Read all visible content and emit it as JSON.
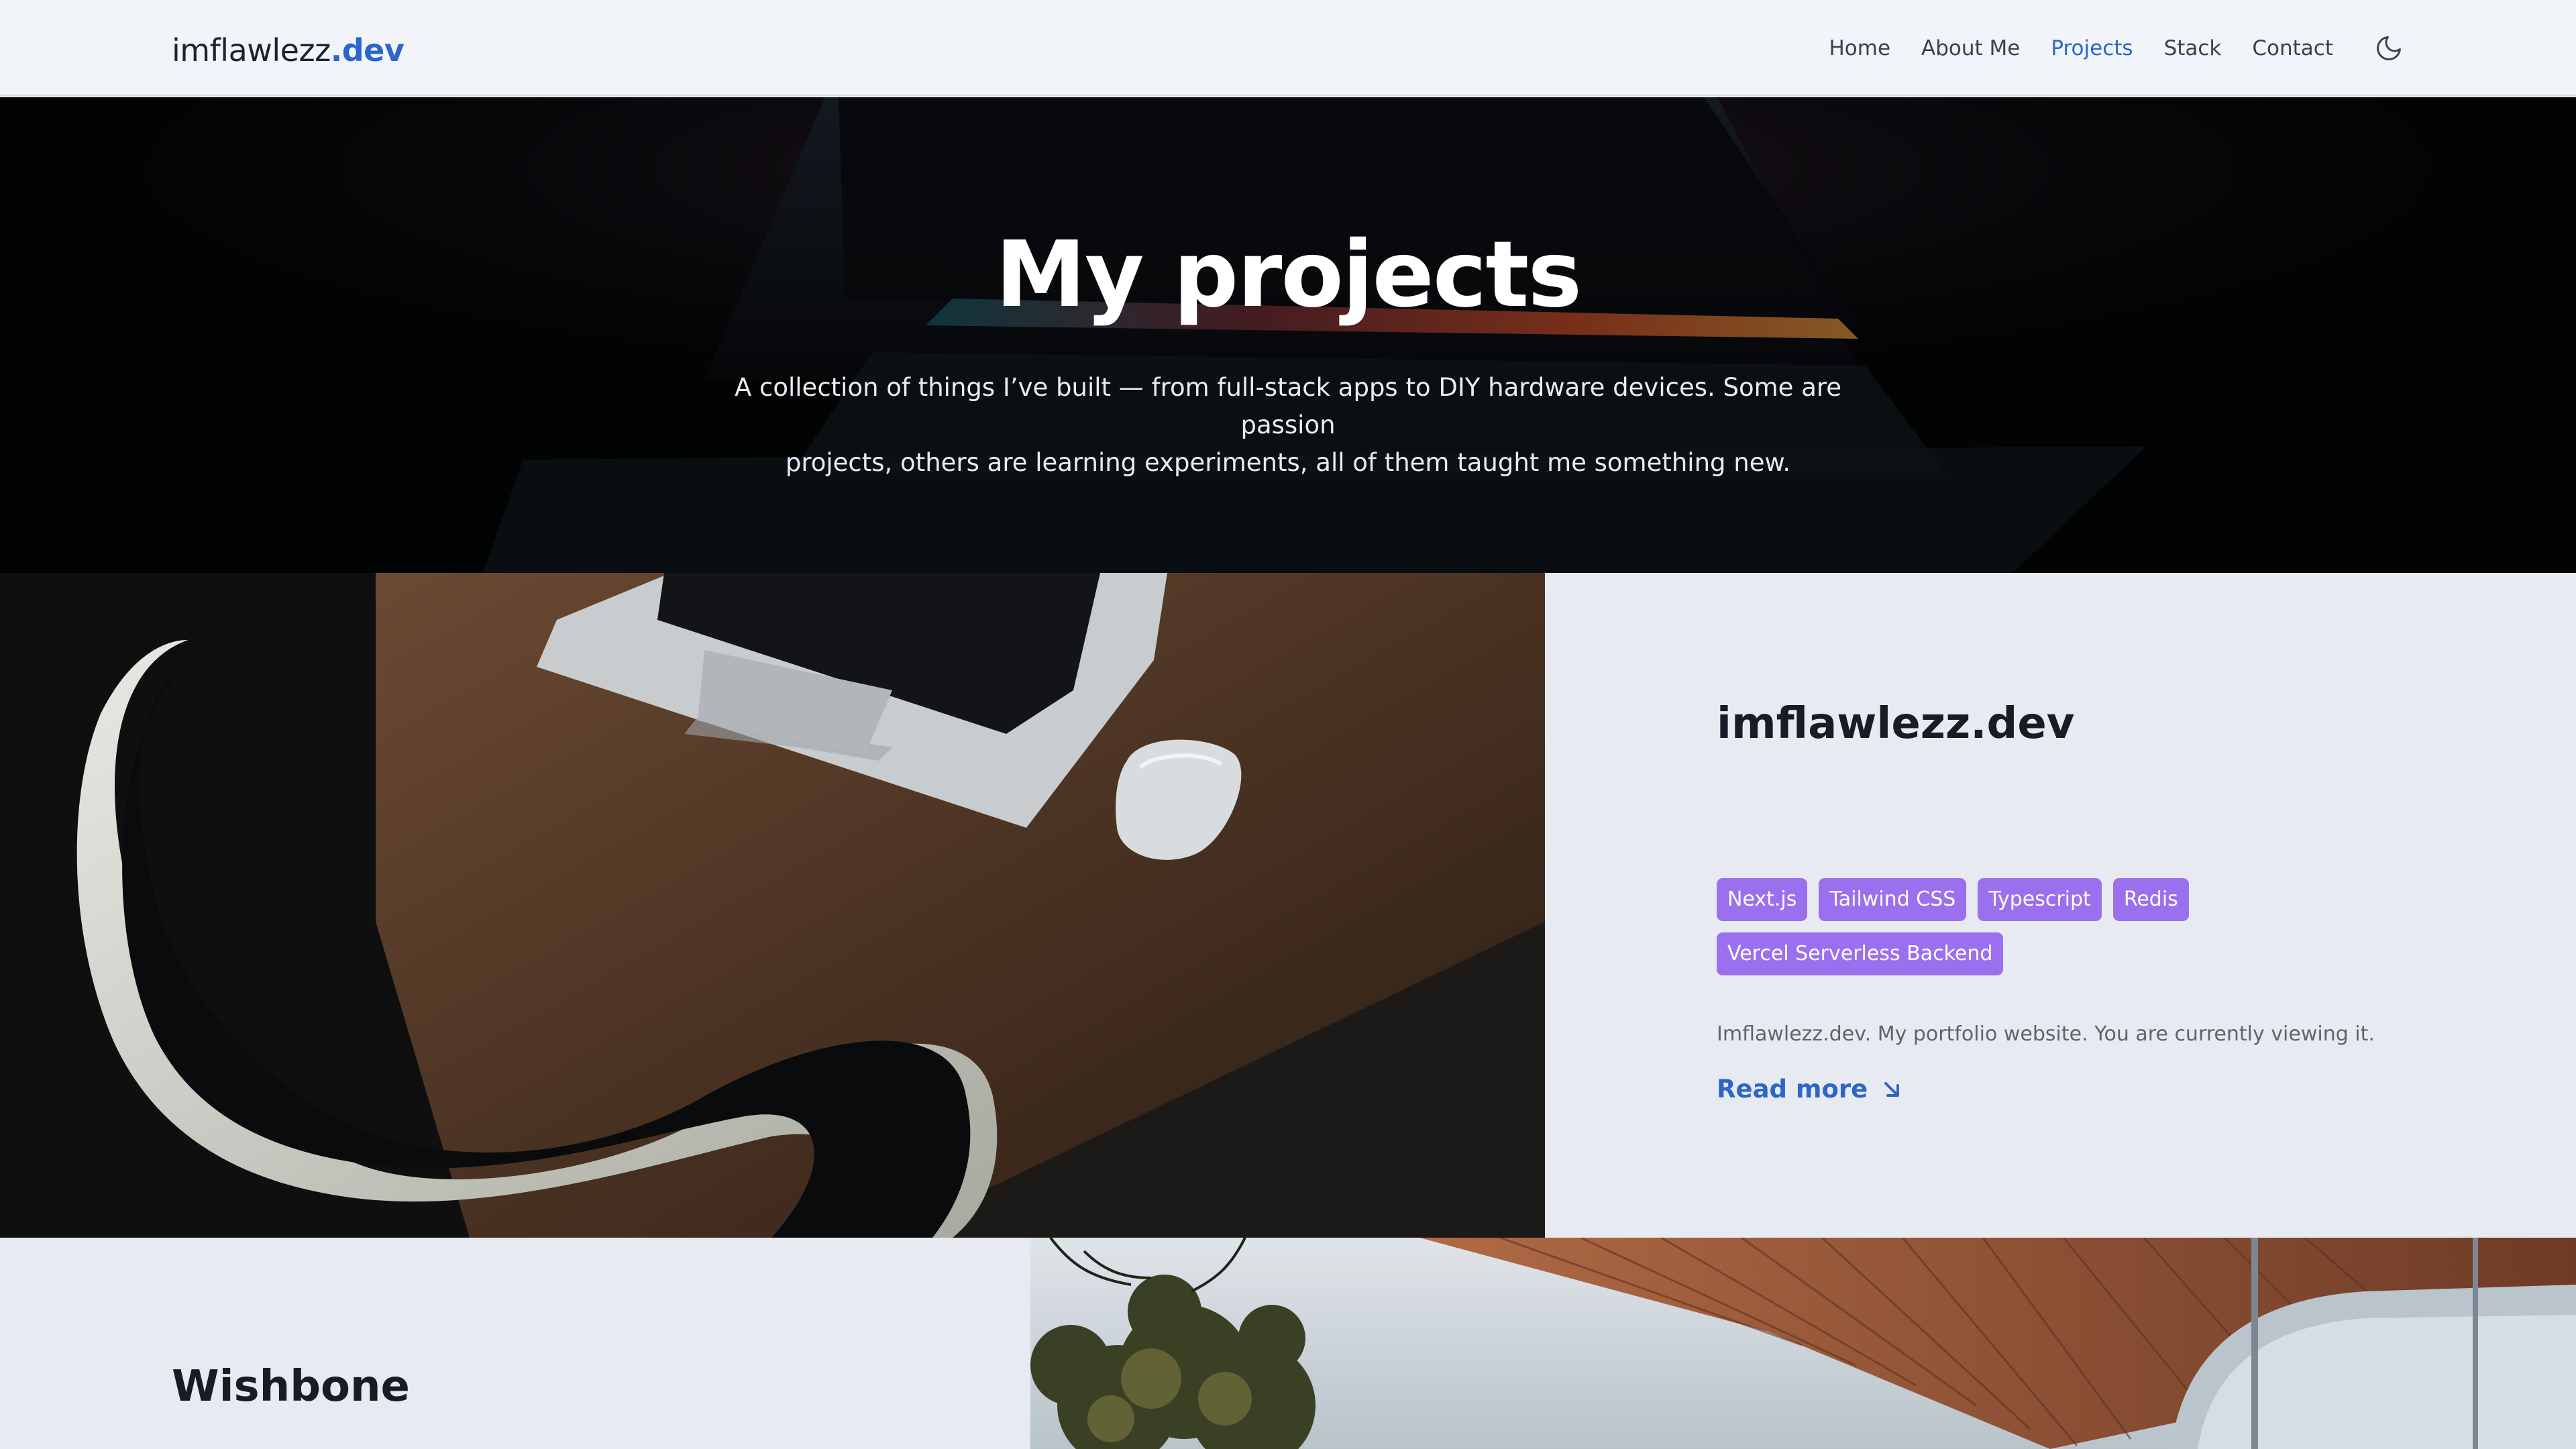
{
  "nav": {
    "logo_main": "imflawlezz",
    "logo_accent": ".dev",
    "links": [
      {
        "label": "Home"
      },
      {
        "label": "About Me"
      },
      {
        "label": "Projects",
        "active": true
      },
      {
        "label": "Stack"
      },
      {
        "label": "Contact"
      }
    ],
    "theme_icon": "moon-icon"
  },
  "hero": {
    "title": "My projects",
    "subtitle_line1": "A collection of things I’ve built — from full-stack apps to DIY hardware devices. Some are passion",
    "subtitle_line2": "projects, others are learning experiments, all of them taught me something new."
  },
  "projects": [
    {
      "title": "imflawlezz.dev",
      "tags": [
        "Next.js",
        "Tailwind CSS",
        "Typescript",
        "Redis",
        "Vercel Serverless Backend"
      ],
      "description": "Imflawlezz.dev. My portfolio website. You are currently viewing it.",
      "read_more": "Read more",
      "read_more_icon": "arrow-down-right-icon"
    },
    {
      "title": "Wishbone"
    }
  ],
  "colors": {
    "accent": "#2d65c8",
    "tag": "#9b70ee",
    "panel": "#e7ebf1",
    "nav_bg": "#f1f4f9"
  }
}
